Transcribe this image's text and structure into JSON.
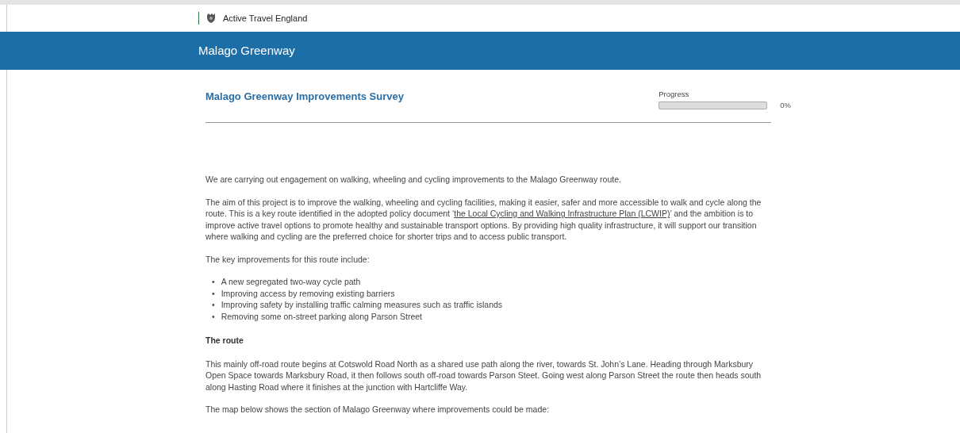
{
  "header": {
    "brand": "Active Travel England"
  },
  "banner": {
    "title": "Malago Greenway"
  },
  "survey": {
    "title": "Malago Greenway Improvements Survey",
    "progress": {
      "label": "Progress",
      "level": 0,
      "reading": "0%"
    }
  },
  "intro": "We are carrying out engagement on walking, wheeling and cycling improvements to the Malago Greenway route.",
  "aim": {
    "before": "The aim of this project is to improve the walking, wheeling and cycling facilities, making it easier, safer and more accessible to walk and cycle along the route. This is a key route identified in the adopted policy document ‘",
    "link": "the Local Cycling and Walking Infrastructure Plan (LCWIP)",
    "after": "’ and the ambition is to improve active travel options to promote healthy and sustainable transport options. By providing high quality infrastructure, it will support our transition where walking and cycling are the preferred choice for shorter trips and to access public transport."
  },
  "improvements_intro": "The key improvements for this route include:",
  "improvements": [
    {
      "bullet": "•",
      "text": "A new segregated two-way cycle path"
    },
    {
      "bullet": "•",
      "text": "Improving access by removing existing barriers"
    },
    {
      "bullet": "•",
      "text": "Improving safety by installing traffic calming measures such as traffic islands"
    },
    {
      "bullet": "•",
      "text": "Removing some on-street parking along Parson Street"
    }
  ],
  "route_heading": "The route",
  "route_text": "This mainly off-road route begins at Cotswold Road North as a shared use path along the river, towards St. John’s Lane. Heading through Marksbury Open Space towards Marksbury Road, it then follows south off-road towards Parson Steet. Going west along Parson Street the route then heads south along Hasting Road where it finishes at the junction with Hartcliffe Way.",
  "map_intro": "The map below shows the section of Malago Greenway where improvements could be made:"
}
